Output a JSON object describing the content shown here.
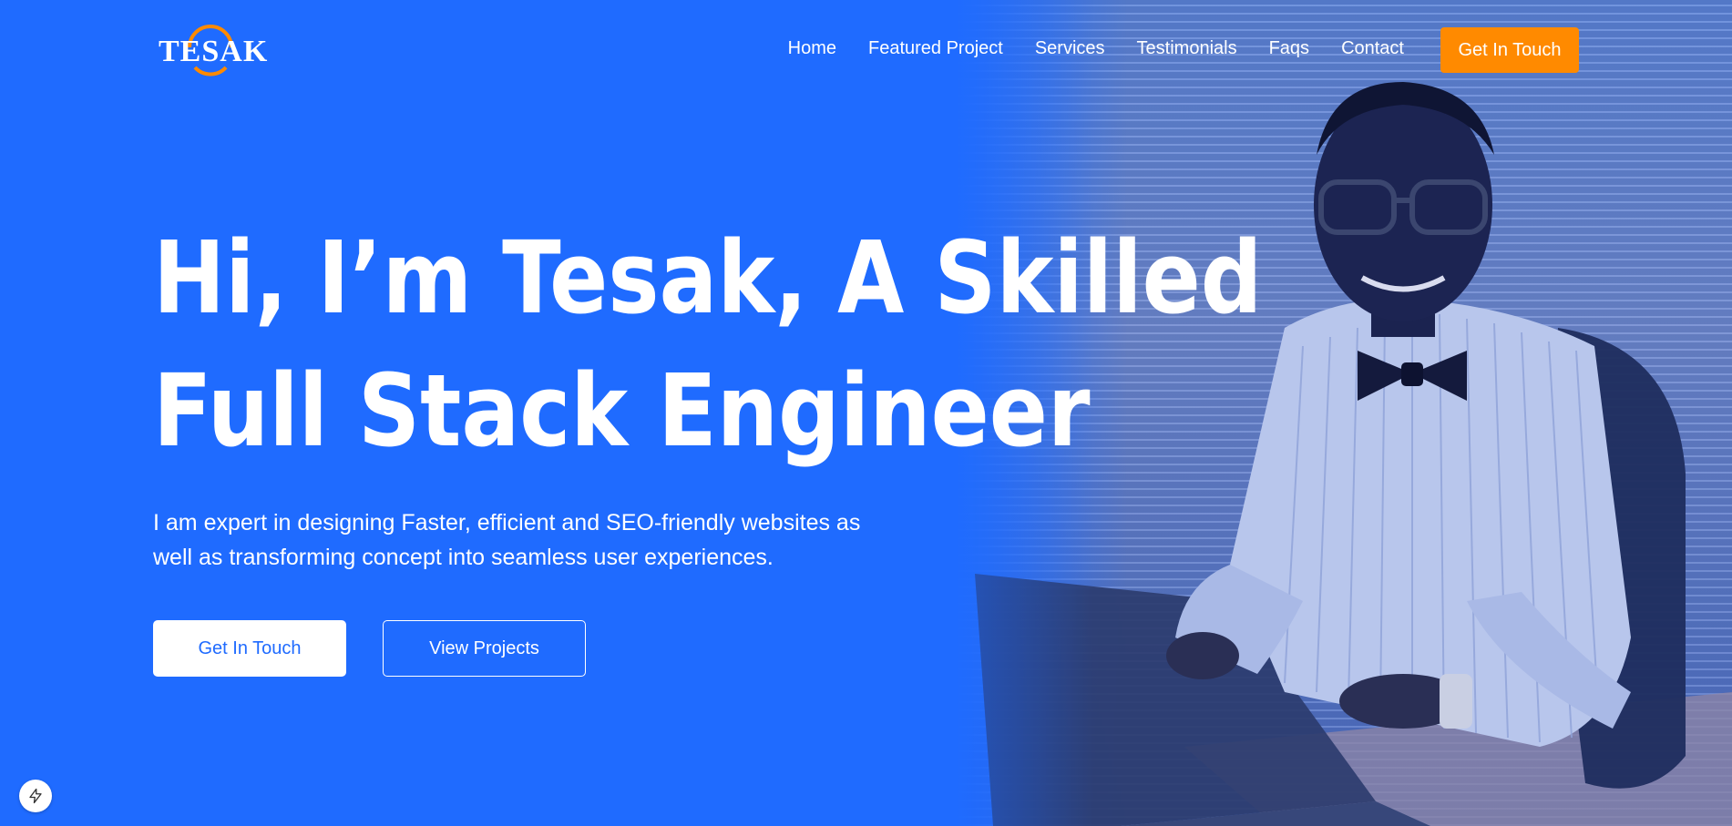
{
  "logo": {
    "text": "TESAK"
  },
  "nav": {
    "items": [
      {
        "label": "Home"
      },
      {
        "label": "Featured Project"
      },
      {
        "label": "Services"
      },
      {
        "label": "Testimonials"
      },
      {
        "label": "Faqs"
      },
      {
        "label": "Contact"
      }
    ],
    "cta_label": "Get In Touch"
  },
  "hero": {
    "headline_line1": "Hi, I’m Tesak, A Skilled",
    "headline_line2": "Full Stack Engineer",
    "subtext": "I am expert in designing Faster, efficient and SEO-friendly websites as well as transforming concept into seamless user experiences.",
    "primary_button": "Get In Touch",
    "secondary_button": "View Projects"
  },
  "colors": {
    "primary_blue": "#1f6bff",
    "accent_orange": "#ff8a00",
    "white": "#ffffff"
  },
  "icons": {
    "badge": "lightning-icon",
    "logo_arc": "arc-icon"
  }
}
